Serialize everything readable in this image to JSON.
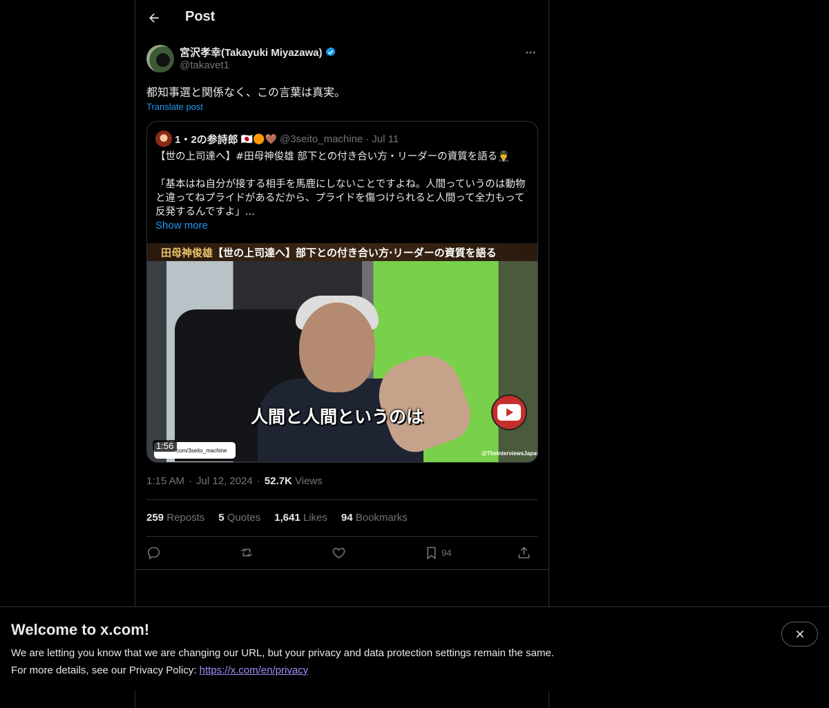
{
  "header": {
    "title": "Post"
  },
  "post": {
    "author_name": "宮沢孝幸(Takayuki Miyazawa)",
    "author_handle": "@takavet1",
    "text": "都知事選と関係なく、この言葉は真実。",
    "translate_label": "Translate post",
    "time": "1:15 AM",
    "date": "Jul 12, 2024",
    "views_count": "52.7K",
    "views_label": "Views",
    "stats": {
      "reposts_count": "259",
      "reposts_label": "Reposts",
      "quotes_count": "5",
      "quotes_label": "Quotes",
      "likes_count": "1,641",
      "likes_label": "Likes",
      "bookmarks_count": "94",
      "bookmarks_label": "Bookmarks"
    },
    "actions": {
      "bookmark_count": "94"
    }
  },
  "quote": {
    "author_name": "1・2の参詩郎",
    "emoji": "🇯🇵🟠🤎",
    "handle": "@3seito_machine",
    "date": "Jul 11",
    "line1": "【世の上司達へ】#田母神俊雄 部下との付き合い方・リーダーの資質を語る👨‍✈️",
    "line2": "「基本はね自分が接する相手を馬鹿にしないことですよね。人間っていうのは動物と違ってねプライドがあるだから、プライドを傷つけられると人間って全力もって反発するんですよ」...",
    "show_more": "Show more",
    "video": {
      "banner_gold": "田母神俊雄",
      "banner_white": "【世の上司達へ】部下との付き合い方·リーダーの資質を語る",
      "caption": "人間と人間というのは",
      "watermark": "@TheInterviewsJapan",
      "link_text": "com/3seito_machine",
      "duration": "1:56"
    }
  },
  "banner": {
    "title": "Welcome to x.com!",
    "line1": "We are letting you know that we are changing our URL, but your privacy and data protection settings remain the same.",
    "line2_prefix": "For more details, see our Privacy Policy:",
    "link": "https://x.com/en/privacy"
  },
  "colors": {
    "accent": "#1d9bf0",
    "background": "#000000",
    "muted": "#71767b",
    "text": "#e7e9ea"
  }
}
